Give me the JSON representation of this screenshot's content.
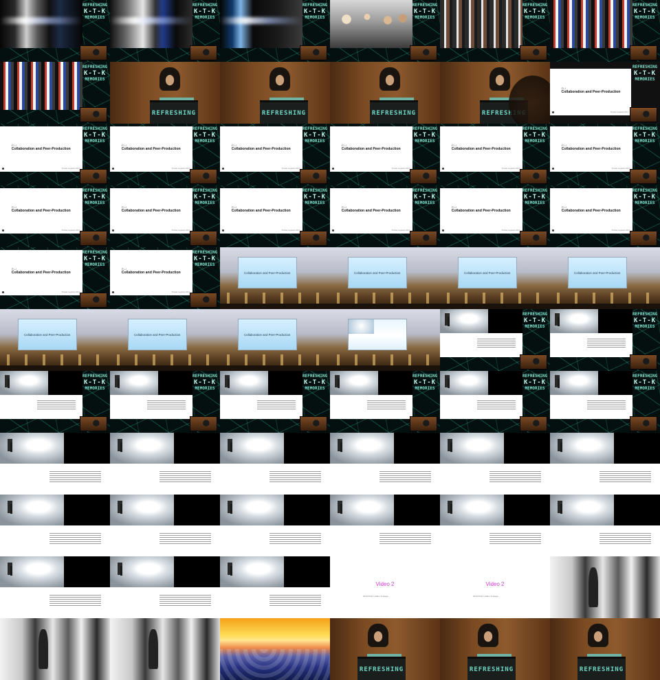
{
  "frames": [
    {
      "type": "street-inset",
      "variant": "s1"
    },
    {
      "type": "street-inset",
      "variant": "s2"
    },
    {
      "type": "street-inset",
      "variant": "s3"
    },
    {
      "type": "crowd-inset",
      "variant": "c1"
    },
    {
      "type": "crowd-inset",
      "variant": "c2"
    },
    {
      "type": "crowd-inset",
      "variant": "c3"
    },
    {
      "type": "crowd-inset",
      "variant": "c3"
    },
    {
      "type": "speaker",
      "variant": "plain"
    },
    {
      "type": "speaker",
      "variant": "plain"
    },
    {
      "type": "speaker",
      "variant": "plain"
    },
    {
      "type": "speaker",
      "variant": "blur"
    },
    {
      "type": "slide-full"
    },
    {
      "type": "slide-inset"
    },
    {
      "type": "slide-inset"
    },
    {
      "type": "slide-inset"
    },
    {
      "type": "slide-inset"
    },
    {
      "type": "slide-inset"
    },
    {
      "type": "slide-inset"
    },
    {
      "type": "slide-inset"
    },
    {
      "type": "slide-inset"
    },
    {
      "type": "slide-inset"
    },
    {
      "type": "slide-inset"
    },
    {
      "type": "slide-inset"
    },
    {
      "type": "slide-inset"
    },
    {
      "type": "slide-inset"
    },
    {
      "type": "slide-inset"
    },
    {
      "type": "hall"
    },
    {
      "type": "hall"
    },
    {
      "type": "hall"
    },
    {
      "type": "hall"
    },
    {
      "type": "hall"
    },
    {
      "type": "hall"
    },
    {
      "type": "hall"
    },
    {
      "type": "hall-photo"
    },
    {
      "type": "split-inset"
    },
    {
      "type": "split-inset"
    },
    {
      "type": "split-inset"
    },
    {
      "type": "split-inset"
    },
    {
      "type": "split-inset"
    },
    {
      "type": "split-inset"
    },
    {
      "type": "split-inset"
    },
    {
      "type": "split-inset"
    },
    {
      "type": "split"
    },
    {
      "type": "split"
    },
    {
      "type": "split"
    },
    {
      "type": "split"
    },
    {
      "type": "split"
    },
    {
      "type": "split"
    },
    {
      "type": "split"
    },
    {
      "type": "split"
    },
    {
      "type": "split"
    },
    {
      "type": "split"
    },
    {
      "type": "split"
    },
    {
      "type": "split"
    },
    {
      "type": "split"
    },
    {
      "type": "split"
    },
    {
      "type": "split"
    },
    {
      "type": "video"
    },
    {
      "type": "video"
    },
    {
      "type": "street-bw"
    },
    {
      "type": "street-bw"
    },
    {
      "type": "street-bw"
    },
    {
      "type": "sky"
    },
    {
      "type": "speaker",
      "variant": "flip"
    },
    {
      "type": "speaker",
      "variant": "flip"
    },
    {
      "type": "speaker",
      "variant": "flip"
    }
  ],
  "brand": {
    "line1": "REFRESHING",
    "line2": "K‑T‑K",
    "line3": "MEMORIES"
  },
  "podium_text": "REFRESHING",
  "slide": {
    "kicker": "PLJ",
    "title": "Collaboration and Peer-Production",
    "footer": "Prosaic Legacies  2013"
  },
  "video": {
    "title": "Video 2",
    "sub": "2013\nArtist / video / footage"
  }
}
